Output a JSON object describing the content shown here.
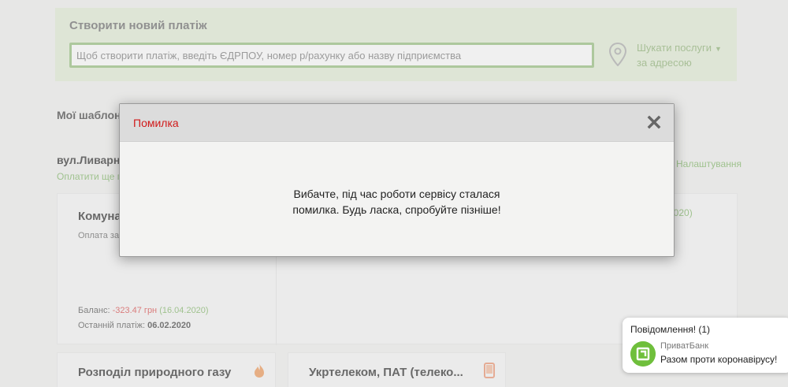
{
  "create_payment": {
    "title": "Створити новий платіж",
    "input_placeholder": "Щоб створити платіж, введіть ЄДРПОУ, номер р/рахунку або назву підприємства",
    "search_services_line1": "Шукати послуги",
    "search_services_line2": "за адресою"
  },
  "templates": {
    "title": "Мої шаблон"
  },
  "address_group": {
    "title": "вул.Ливарн",
    "pay_all_link": "Оплатити ще п",
    "settings_link": "Налаштування"
  },
  "main_card": {
    "title": "Комуна",
    "subtitle": "Оплата за",
    "right_date": "2020)",
    "balance_label": "Баланс: ",
    "balance_value": "-323.47 грн",
    "balance_date": "(16.04.2020)",
    "last_payment_label": "Останній платіж: ",
    "last_payment_date": "06.02.2020"
  },
  "cards": {
    "gas_title": "Розподіл природного газу",
    "ukrtelecom_title": "Укртелеком, ПАТ (телеко..."
  },
  "modal": {
    "title": "Помилка",
    "message_line1": "Вибачте, під час роботи сервісу сталася",
    "message_line2": "помилка. Будь ласка, спробуйте пізніше!",
    "close_icon": "close-icon"
  },
  "notification": {
    "title": "Повідомлення! (1)",
    "sender": "ПриватБанк",
    "text": "Разом проти коронавірусу!"
  },
  "colors": {
    "error_red": "#d11a1a",
    "accent_green": "#8fbf78",
    "negative_red": "#e05f5f"
  }
}
